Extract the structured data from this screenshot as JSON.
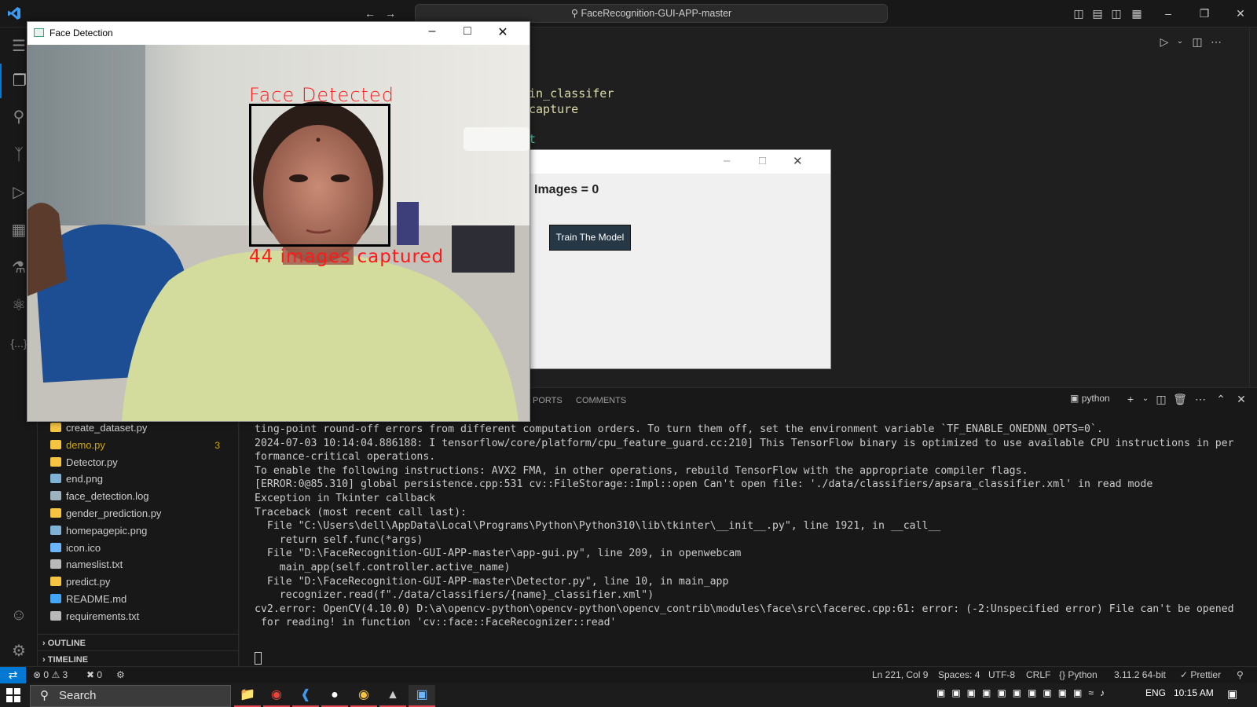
{
  "titlebar": {
    "search_text": "FaceRecognition-GUI-APP-master"
  },
  "editor": {
    "code_lines": [
      "in_classifer",
      "capture",
      "t"
    ]
  },
  "sidebar": {
    "files": [
      {
        "name": "create_dataset.py",
        "type": "py",
        "count": ""
      },
      {
        "name": "demo.py",
        "type": "py",
        "count": "3"
      },
      {
        "name": "Detector.py",
        "type": "py",
        "count": ""
      },
      {
        "name": "end.png",
        "type": "png",
        "count": ""
      },
      {
        "name": "face_detection.log",
        "type": "log",
        "count": ""
      },
      {
        "name": "gender_prediction.py",
        "type": "py",
        "count": ""
      },
      {
        "name": "homepagepic.png",
        "type": "png",
        "count": ""
      },
      {
        "name": "icon.ico",
        "type": "ico",
        "count": ""
      },
      {
        "name": "nameslist.txt",
        "type": "txt",
        "count": ""
      },
      {
        "name": "predict.py",
        "type": "py",
        "count": ""
      },
      {
        "name": "README.md",
        "type": "md",
        "count": ""
      },
      {
        "name": "requirements.txt",
        "type": "txt",
        "count": ""
      }
    ],
    "outline_label": "OUTLINE",
    "timeline_label": "TIMELINE"
  },
  "panel": {
    "tabs": [
      "PORTS",
      "COMMENTS"
    ],
    "terminal_name": "python",
    "terminal_lines": [
      "ting-point round-off errors from different computation orders. To turn them off, set the environment variable `TF_ENABLE_ONEDNN_OPTS=0`.",
      "2024-07-03 10:14:04.886188: I tensorflow/core/platform/cpu_feature_guard.cc:210] This TensorFlow binary is optimized to use available CPU instructions in per",
      "formance-critical operations.",
      "To enable the following instructions: AVX2 FMA, in other operations, rebuild TensorFlow with the appropriate compiler flags.",
      "[ERROR:0@85.310] global persistence.cpp:531 cv::FileStorage::Impl::open Can't open file: './data/classifiers/apsara_classifier.xml' in read mode",
      "Exception in Tkinter callback",
      "Traceback (most recent call last):",
      "  File \"C:\\Users\\dell\\AppData\\Local\\Programs\\Python\\Python310\\lib\\tkinter\\__init__.py\", line 1921, in __call__",
      "    return self.func(*args)",
      "  File \"D:\\FaceRecognition-GUI-APP-master\\app-gui.py\", line 209, in openwebcam",
      "    main_app(self.controller.active_name)",
      "  File \"D:\\FaceRecognition-GUI-APP-master\\Detector.py\", line 10, in main_app",
      "    recognizer.read(f\"./data/classifiers/{name}_classifier.xml\")",
      "cv2.error: OpenCV(4.10.0) D:\\a\\opencv-python\\opencv-python\\opencv_contrib\\modules\\face\\src\\facerec.cpp:61: error: (-2:Unspecified error) File can't be opened",
      " for reading! in function 'cv::face::FaceRecognizer::read'"
    ]
  },
  "statusbar": {
    "errors": "0",
    "warnings": "3",
    "ports": "0",
    "position": "Ln 221, Col 9",
    "spaces": "Spaces: 4",
    "encoding": "UTF-8",
    "eol": "CRLF",
    "language": "Python",
    "interpreter": "3.11.2 64-bit",
    "formatter": "Prettier"
  },
  "taskbar": {
    "search_label": "Search",
    "language": "ENG",
    "time": "10:15 AM"
  },
  "tk_window": {
    "images_label": "Images = 0",
    "train_button": "Train The Model"
  },
  "face_window": {
    "title": "Face Detection",
    "face_label": "Face Detected",
    "capture_label": "44 images captured"
  },
  "colors": {
    "accent": "#0078d4",
    "error_text": "#ff1a1a",
    "tk_button": "#263845"
  }
}
